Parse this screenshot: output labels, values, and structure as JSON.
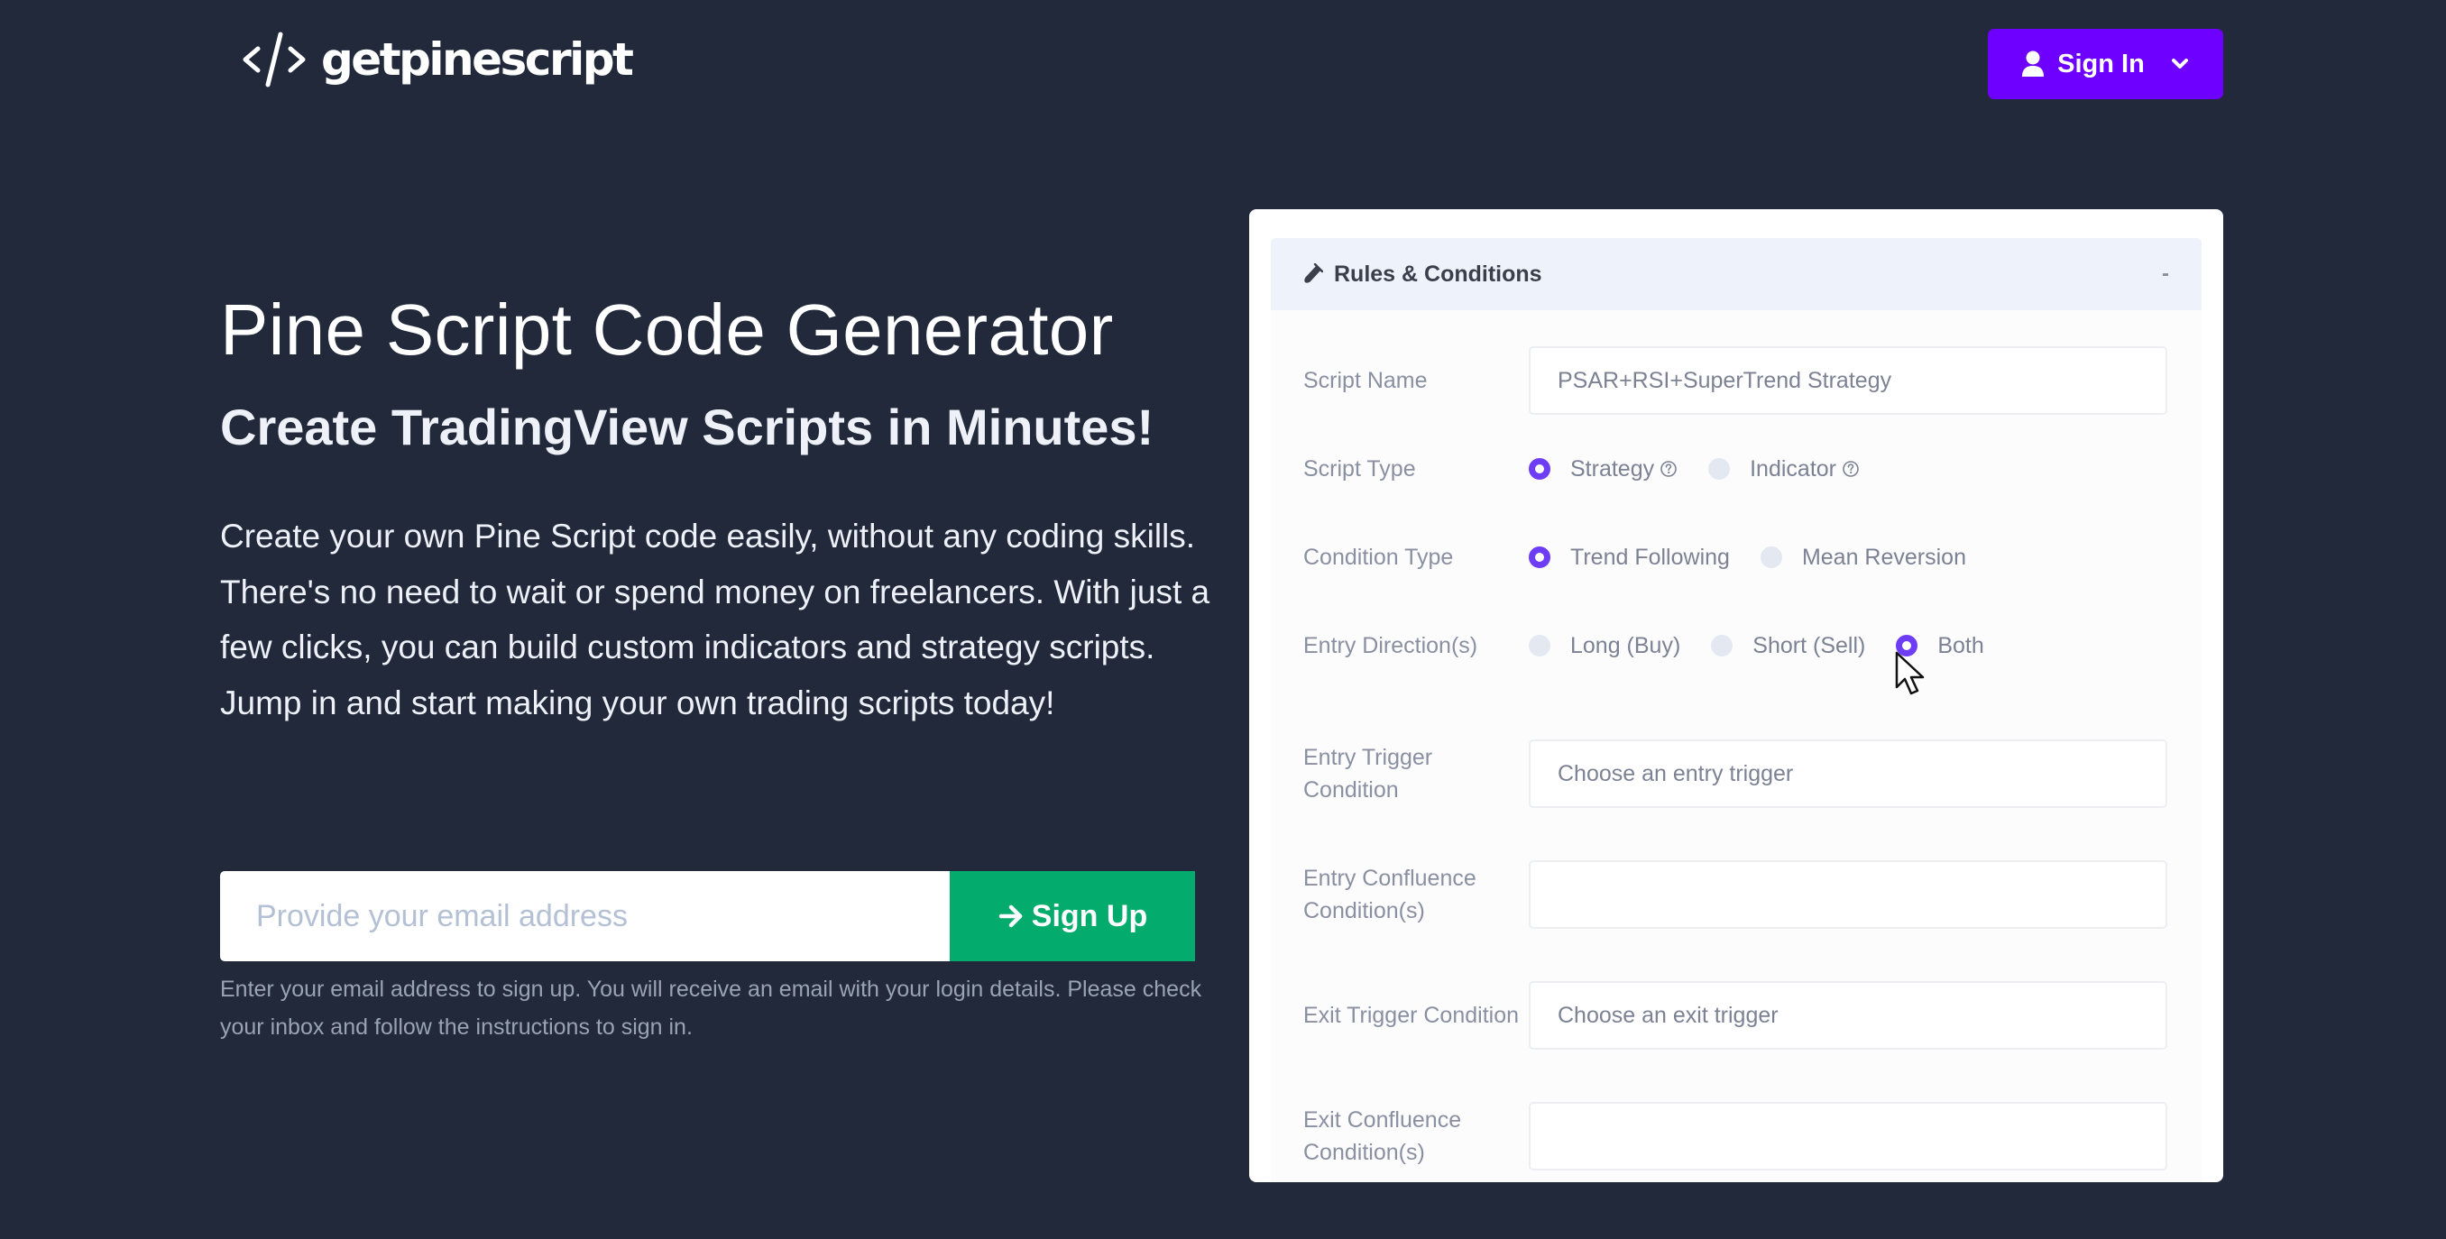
{
  "header": {
    "brand": "getpinescript",
    "logo_icon": "code-slash-icon",
    "signin_label": "Sign In",
    "signin_icon": "user-icon",
    "signin_caret_icon": "chevron-down-icon",
    "accent_color": "#6d00ff"
  },
  "hero": {
    "title": "Pine Script Code Generator",
    "subtitle": "Create TradingView Scripts in Minutes!",
    "description": "Create your own Pine Script code easily, without any coding skills. There's no need to wait or spend money on freelancers. With just a few clicks, you can build custom indicators and strategy scripts. Jump in and start making your own trading scripts today!",
    "signup": {
      "email_placeholder": "Provide your email address",
      "email_value": "",
      "button_label": "Sign Up",
      "button_icon": "arrow-right-icon",
      "button_color": "#03ab6c",
      "help_text": "Enter your email address to sign up. You will receive an email with your login details. Please check your inbox and follow the instructions to sign in."
    }
  },
  "panel": {
    "title": "Rules & Conditions",
    "title_icon": "flask-icon",
    "collapse_label": "-",
    "fields": {
      "script_name": {
        "label": "Script Name",
        "value": "PSAR+RSI+SuperTrend Strategy"
      },
      "script_type": {
        "label": "Script Type",
        "options": [
          {
            "label": "Strategy",
            "checked": true,
            "help": true
          },
          {
            "label": "Indicator",
            "checked": false,
            "help": true
          }
        ]
      },
      "condition_type": {
        "label": "Condition Type",
        "options": [
          {
            "label": "Trend Following",
            "checked": true
          },
          {
            "label": "Mean Reversion",
            "checked": false
          }
        ]
      },
      "entry_direction": {
        "label": "Entry Direction(s)",
        "options": [
          {
            "label": "Long (Buy)",
            "checked": false
          },
          {
            "label": "Short (Sell)",
            "checked": false
          },
          {
            "label": "Both",
            "checked": true
          }
        ]
      },
      "entry_trigger": {
        "label": "Entry Trigger Condition",
        "placeholder": "Choose an entry trigger",
        "value": ""
      },
      "entry_confluence": {
        "label": "Entry Confluence Condition(s)",
        "placeholder": "",
        "value": ""
      },
      "exit_trigger": {
        "label": "Exit Trigger Condition",
        "placeholder": "Choose an exit trigger",
        "value": ""
      },
      "exit_confluence": {
        "label": "Exit Confluence Condition(s)",
        "placeholder": "",
        "value": ""
      }
    },
    "radio_accent": "#6d3cf5"
  }
}
